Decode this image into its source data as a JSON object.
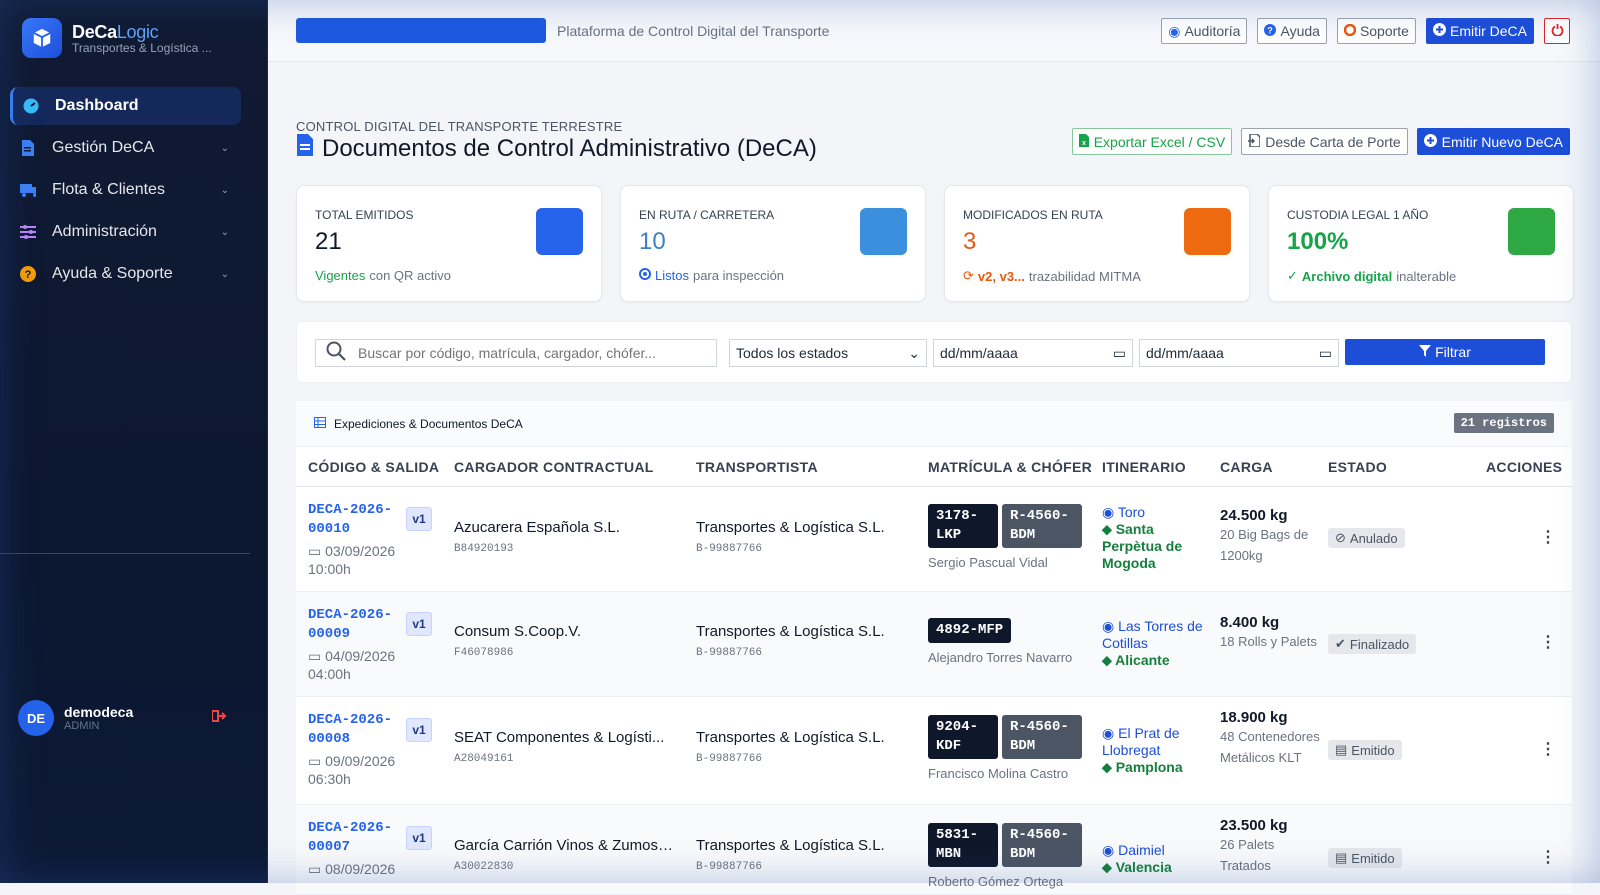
{
  "brand": {
    "name_a": "DeCa",
    "name_b": "Logic",
    "subtitle": "Transportes & Logística ..."
  },
  "sidebar": {
    "items": [
      {
        "label": "Dashboard",
        "icon": "dashboard-icon"
      },
      {
        "label": "Gestión DeCA",
        "icon": "document-icon"
      },
      {
        "label": "Flota & Clientes",
        "icon": "truck-icon"
      },
      {
        "label": "Administración",
        "icon": "sliders-icon"
      },
      {
        "label": "Ayuda & Soporte",
        "icon": "question-icon"
      }
    ]
  },
  "user": {
    "initials": "DE",
    "name": "demodeca",
    "role": "ADMIN"
  },
  "topbar": {
    "platform": "Plataforma de Control Digital del Transporte",
    "audit": "Auditoría",
    "help": "Ayuda",
    "support": "Soporte",
    "emit": "Emitir DeCA"
  },
  "page": {
    "eyebrow": "CONTROL DIGITAL DEL TRANSPORTE TERRESTRE",
    "title": "Documentos de Control Administrativo (DeCA)",
    "export": "Exportar Excel / CSV",
    "from_carta": "Desde Carta de Porte",
    "new": "Emitir Nuevo DeCA"
  },
  "stats": [
    {
      "label": "TOTAL EMITIDOS",
      "value": "21",
      "note_hl": "Vigentes",
      "note": "con QR activo",
      "color": "#2563eb",
      "val_color": "#111827",
      "hl_color": "#16a34a"
    },
    {
      "label": "EN RUTA / CARRETERA",
      "value": "10",
      "note_hl": "Listos",
      "note": "para inspección",
      "color": "#3b8fdd",
      "val_color": "#3b82c4",
      "hl_color": "#2563eb"
    },
    {
      "label": "MODIFICADOS EN RUTA",
      "value": "3",
      "note_hl": "v2, v3...",
      "note": "trazabilidad MITMA",
      "color": "#ee6a10",
      "val_color": "#ea580c",
      "hl_color": "#ea580c"
    },
    {
      "label": "CUSTODIA LEGAL 1 AÑO",
      "value": "100%",
      "note_hl": "Archivo digital",
      "note": "inalterable",
      "color": "#2ea843",
      "val_color": "#16a34a",
      "hl_color": "#16a34a"
    }
  ],
  "filters": {
    "search_placeholder": "Buscar por código, matrícula, cargador, chófer...",
    "status": "Todos los estados",
    "date_from": "dd/mm/aaaa",
    "date_to": "dd/mm/aaaa",
    "button": "Filtrar"
  },
  "table": {
    "caption": "Expediciones & Documentos DeCA",
    "count": "21 registros",
    "headers": [
      "CÓDIGO & SALIDA",
      "CARGADOR CONTRACTUAL",
      "TRANSPORTISTA",
      "MATRÍCULA & CHÓFER",
      "ITINERARIO",
      "CARGA",
      "ESTADO",
      "ACCIONES"
    ],
    "rows": [
      {
        "code": "DECA-2026-00010",
        "version": "v1",
        "date": "03/09/2026",
        "time": "10:00h",
        "shipper": "Azucarera Española S.L.",
        "shipper_id": "B84920193",
        "carrier": "Transportes & Logística S.L.",
        "carrier_id": "B-99887766",
        "plate": "3178-LKP",
        "trailer": "R-4560-BDM",
        "driver": "Sergio Pascual Vidal",
        "origin": "Toro",
        "dest": "Santa Perpètua de Mogoda",
        "kg": "24.500 kg",
        "desc": "20 Big Bags de 1200kg",
        "status": "Anulado"
      },
      {
        "code": "DECA-2026-00009",
        "version": "v1",
        "date": "04/09/2026",
        "time": "04:00h",
        "shipper": "Consum S.Coop.V.",
        "shipper_id": "F46078986",
        "carrier": "Transportes & Logística S.L.",
        "carrier_id": "B-99887766",
        "plate": "4892-MFP",
        "trailer": "",
        "driver": "Alejandro Torres Navarro",
        "origin": "Las Torres de Cotillas",
        "dest": "Alicante",
        "kg": "8.400 kg",
        "desc": "18 Rolls y Palets",
        "status": "Finalizado"
      },
      {
        "code": "DECA-2026-00008",
        "version": "v1",
        "date": "09/09/2026",
        "time": "06:30h",
        "shipper": "SEAT Componentes & Logísti...",
        "shipper_id": "A28049161",
        "carrier": "Transportes & Logística S.L.",
        "carrier_id": "B-99887766",
        "plate": "9204-KDF",
        "trailer": "R-4560-BDM",
        "driver": "Francisco Molina Castro",
        "origin": "El Prat de Llobregat",
        "dest": "Pamplona",
        "kg": "18.900 kg",
        "desc": "48 Contenedores Metálicos KLT",
        "status": "Emitido"
      },
      {
        "code": "DECA-2026-00007",
        "version": "v1",
        "date": "08/09/2026",
        "time": "",
        "shipper": "García Carrión Vinos & Zumos ...",
        "shipper_id": "A30022830",
        "carrier": "Transportes & Logística S.L.",
        "carrier_id": "B-99887766",
        "plate": "5831-MBN",
        "trailer": "R-4560-BDM",
        "driver": "Roberto Gómez Ortega",
        "origin": "Daimiel",
        "dest": "Valencia",
        "kg": "23.500 kg",
        "desc": "26 Palets Tratados",
        "status": "Emitido"
      }
    ]
  }
}
